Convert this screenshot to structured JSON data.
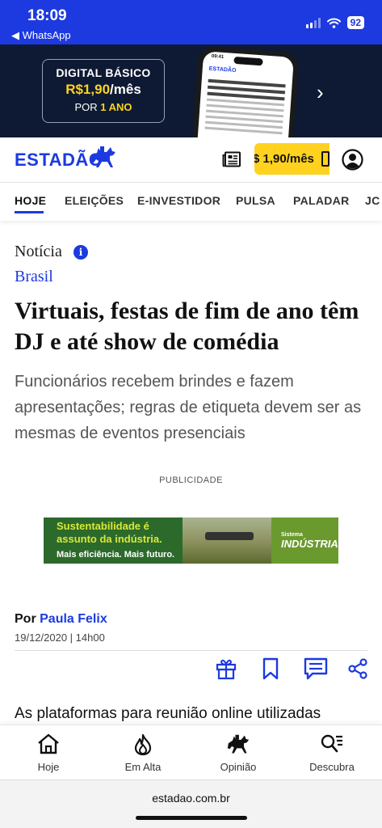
{
  "status_bar": {
    "time": "18:09",
    "back_app": "◀ WhatsApp",
    "battery": "92"
  },
  "promo_banner": {
    "line1": "DIGITAL BÁSICO",
    "price": "R$1,90",
    "per": "/mês",
    "period_prefix": "POR ",
    "period": "1 ANO",
    "phone_time": "09:41",
    "phone_logo": "ESTADÃO",
    "chevron": "›"
  },
  "header": {
    "logo": "ESTADÃO",
    "subscribe_label": "$ 1,90/mês"
  },
  "nav": {
    "items": [
      "HOJE",
      "ELEIÇÕES",
      "E-INVESTIDOR",
      "PULSA",
      "PALADAR",
      "JC"
    ]
  },
  "article": {
    "kicker": "Notícia",
    "section": "Brasil",
    "headline": "Virtuais, festas de fim de ano têm DJ e até show de comédia",
    "subheadline": "Funcionários recebem brindes e fazem apresentações; regras de etiqueta devem ser as mesmas de eventos presenciais",
    "byline_prefix": "Por ",
    "author": "Paula Felix",
    "date": "19/12/2020 | 14h00",
    "teaser": "As plataformas para reunião online utilizadas"
  },
  "ad": {
    "label": "PUBLICIDADE",
    "title": "Sustentabilidade é assunto da indústria.",
    "subtitle": "Mais eficiência. Mais futuro.",
    "brand_small": "Sistema",
    "brand": "INDÚSTRIA"
  },
  "tabbar": {
    "items": [
      {
        "label": "Hoje",
        "icon": "home-icon"
      },
      {
        "label": "Em Alta",
        "icon": "flame-icon"
      },
      {
        "label": "Opinião",
        "icon": "horse-icon"
      },
      {
        "label": "Descubra",
        "icon": "search-list-icon"
      }
    ]
  },
  "browser": {
    "url": "estadao.com.br"
  },
  "colors": {
    "brand_blue": "#1c3ae0",
    "accent_yellow": "#ffd21f",
    "banner_navy": "#0e1a33"
  }
}
